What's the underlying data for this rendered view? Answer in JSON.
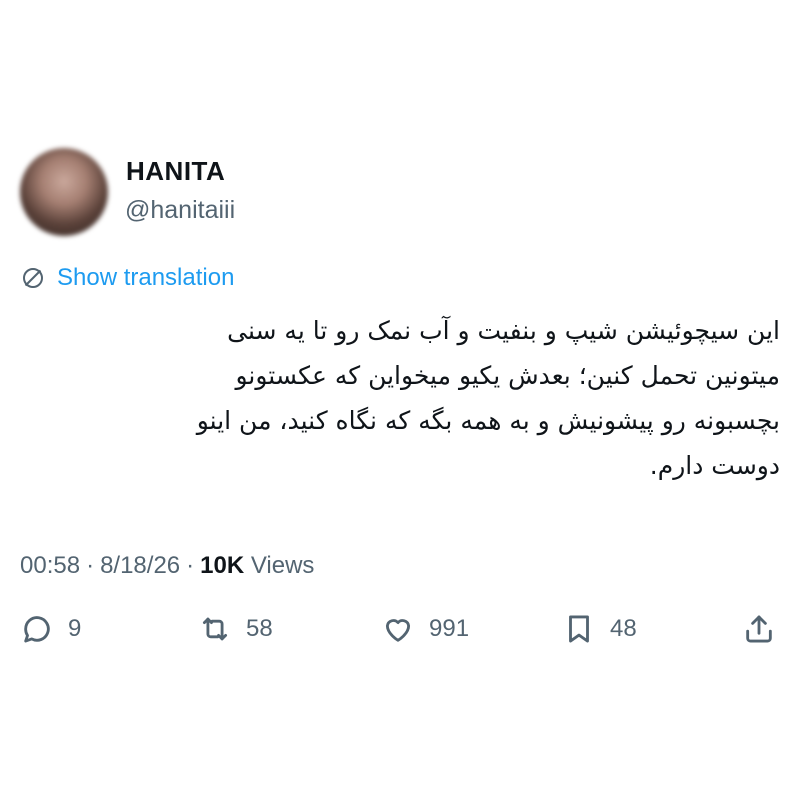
{
  "author": {
    "display_name": "HANITA",
    "handle": "@hanitaiii",
    "avatar_icon": "blurred-profile-photo"
  },
  "translate": {
    "label": "Show translation",
    "icon": "globe-icon",
    "color": "#1d9bf0"
  },
  "tweet": {
    "lines": [
      "این سیچوئیشن شیپ و بنفیت و آب نمک رو تا یه سنی",
      "میتونین تحمل کنین؛ بعدش یکیو میخواین که عکستونو",
      "بچسبونه رو پیشونیش و به همه بگه که نگاه کنید، من اینو",
      "دوست دارم."
    ]
  },
  "meta": {
    "time": "00:58",
    "date": "8/18/26",
    "views_count": "10K",
    "views_label": "Views"
  },
  "actions": {
    "replies": "9",
    "retweets": "58",
    "likes": "991",
    "bookmarks": "48"
  },
  "colors": {
    "text": "#0f1419",
    "secondary": "#536471",
    "link": "#1d9bf0"
  }
}
